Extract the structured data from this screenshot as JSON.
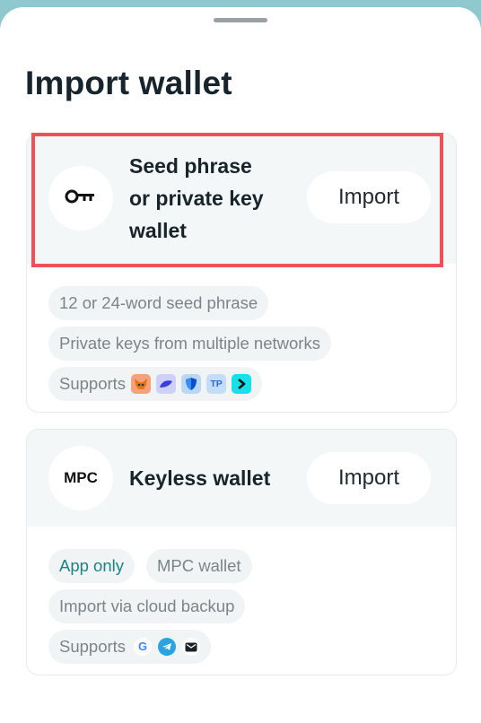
{
  "page": {
    "title": "Import wallet"
  },
  "cards": [
    {
      "title_lines": [
        "Seed phrase",
        "or private key",
        "wallet"
      ],
      "button": "Import",
      "icon": "key-icon",
      "chips": [
        "12 or 24-word seed phrase",
        "Private keys from multiple networks"
      ],
      "supports_label": "Supports",
      "supports_icons": [
        "metamask-icon",
        "okx-icon",
        "trust-wallet-icon",
        "tokenpocket-icon",
        "kraken-icon"
      ],
      "tp_text": "TP"
    },
    {
      "title": "Keyless wallet",
      "button": "Import",
      "icon_text": "MPC",
      "chips": [
        "App only",
        "MPC wallet",
        "Import via cloud backup"
      ],
      "supports_label": "Supports",
      "supports_icons": [
        "google-icon",
        "telegram-icon",
        "email-icon"
      ],
      "google_text": "G"
    }
  ],
  "colors": {
    "accent": "#1a8383",
    "highlight": "#ef5157",
    "chip_bg": "#f1f4f4"
  }
}
